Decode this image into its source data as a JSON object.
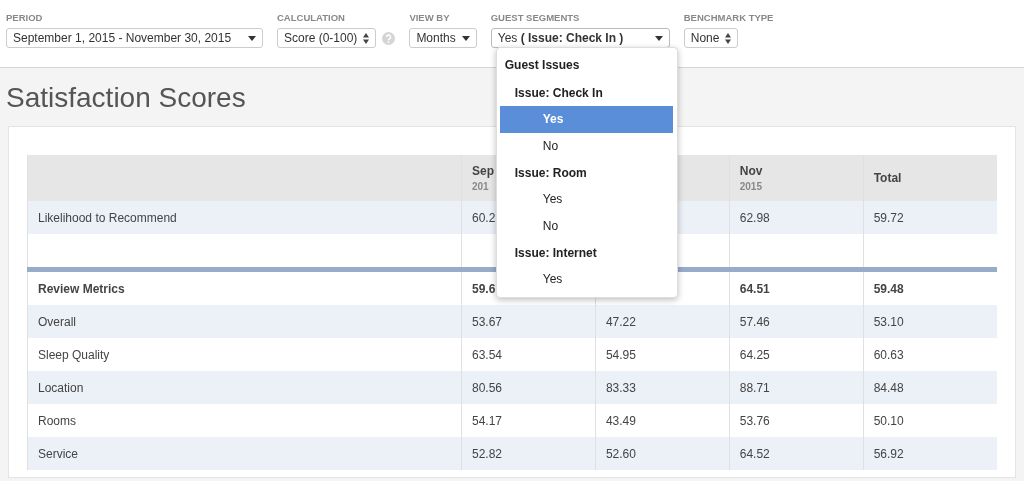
{
  "filters": [
    {
      "label": "PERIOD",
      "value": "September 1, 2015 - November 30, 2015",
      "kind": "dropdown"
    },
    {
      "label": "CALCULATION",
      "value": "Score (0-100)",
      "kind": "spinner",
      "help": true
    },
    {
      "label": "VIEW BY",
      "value": "Months",
      "kind": "dropdown"
    },
    {
      "label": "GUEST SEGMENTS",
      "value": "Yes **( Issue: Check In )**",
      "kind": "dropdown",
      "expanded": true
    },
    {
      "label": "BENCHMARK TYPE",
      "value": "None",
      "kind": "spinner"
    }
  ],
  "segment_menu": {
    "heading": "Guest Issues",
    "groups": [
      {
        "label": "Issue: Check In",
        "options": [
          {
            "label": "Yes",
            "selected": true
          },
          {
            "label": "No",
            "selected": false
          }
        ]
      },
      {
        "label": "Issue: Room",
        "options": [
          {
            "label": "Yes",
            "selected": false
          },
          {
            "label": "No",
            "selected": false
          }
        ]
      },
      {
        "label": "Issue: Internet",
        "options": [
          {
            "label": "Yes",
            "selected": false
          }
        ]
      }
    ]
  },
  "page_title": "Satisfaction Scores",
  "table": {
    "columns": [
      {},
      {
        "label": "Sep",
        "sublabel": "201"
      },
      {},
      {
        "label": "Nov",
        "sublabel": "2015"
      },
      {
        "label": "Total"
      }
    ],
    "rows": [
      {
        "kind": "data",
        "cells": [
          "Likelihood to Recommend",
          "60.2",
          "",
          "62.98",
          "59.72"
        ]
      },
      {
        "kind": "spacer"
      },
      {
        "kind": "section",
        "cells": [
          "Review Metrics",
          "59.6",
          "",
          "64.51",
          "59.48"
        ]
      },
      {
        "kind": "data",
        "cells": [
          "Overall",
          "53.67",
          "47.22",
          "57.46",
          "53.10"
        ]
      },
      {
        "kind": "data",
        "cells": [
          "Sleep Quality",
          "63.54",
          "54.95",
          "64.25",
          "60.63"
        ]
      },
      {
        "kind": "data",
        "cells": [
          "Location",
          "80.56",
          "83.33",
          "88.71",
          "84.48"
        ]
      },
      {
        "kind": "data",
        "cells": [
          "Rooms",
          "54.17",
          "43.49",
          "53.76",
          "50.10"
        ]
      },
      {
        "kind": "data",
        "cells": [
          "Service",
          "52.82",
          "52.60",
          "64.52",
          "56.92"
        ]
      }
    ]
  }
}
